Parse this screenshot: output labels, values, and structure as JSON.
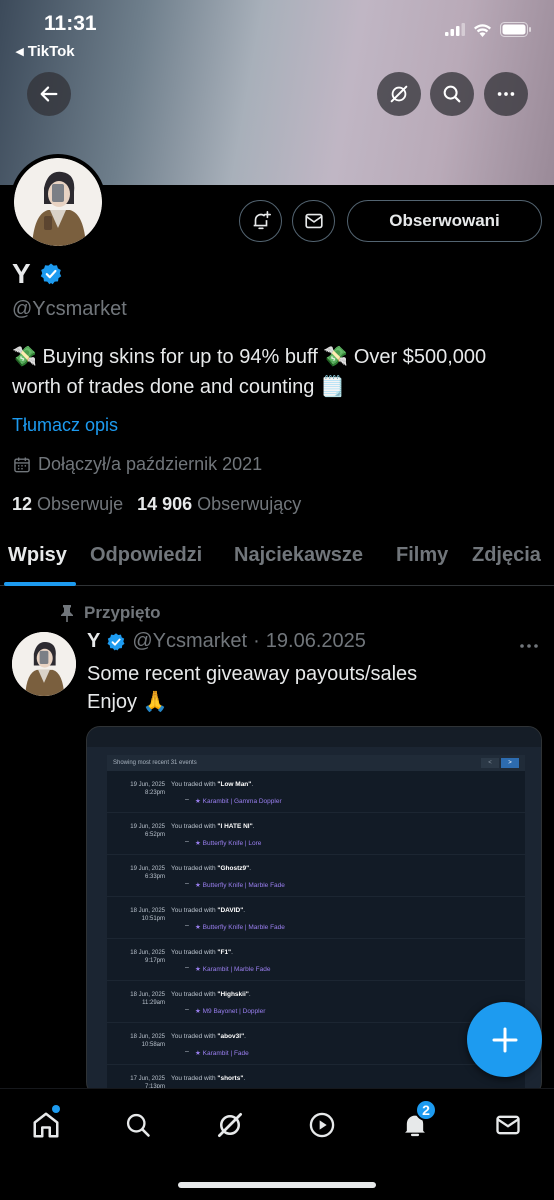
{
  "status_bar": {
    "time": "11:31",
    "back_app": "◂ TikTok"
  },
  "colors": {
    "accent": "#1d9bf0",
    "background": "#000000",
    "muted": "#71767b"
  },
  "header": {
    "back_icon": "arrow-left-icon",
    "grok_icon": "grok-icon",
    "search_icon": "search-icon",
    "more_icon": "more-icon",
    "follow_label": "Obserwowani"
  },
  "profile": {
    "name": "Y",
    "handle": "@Ycsmarket",
    "bio_line1": "💸 Buying skins for up to 94% buff 💸 Over $500,000",
    "bio_line2": "worth of trades done and counting 🗒️",
    "translate": "Tłumacz opis",
    "joined": "Dołączył/a październik 2021",
    "following_count": "12",
    "following_label": "Obserwuje",
    "followers_count": "14 906",
    "followers_label": "Obserwujący"
  },
  "tabs": [
    "Wpisy",
    "Odpowiedzi",
    "Najciekawsze",
    "Filmy",
    "Zdjęcia"
  ],
  "pinned_tweet": {
    "pinned_label": "Przypięto",
    "name": "Y",
    "handle": "@Ycsmarket",
    "separator": "·",
    "date": "19.06.2025",
    "text_line1": "Some recent giveaway payouts/sales",
    "text_line2": "Enjoy 🙏",
    "media": {
      "header": "Showing most recent 31 events",
      "pager_prev": "<",
      "pager_next": ">",
      "trades": [
        {
          "date": "19 Jun, 2025",
          "time": "8:23pm",
          "prefix": "You traded with ",
          "user": "\"Low Man\"",
          "item": "★ Karambit | Gamma Doppler"
        },
        {
          "date": "19 Jun, 2025",
          "time": "6:52pm",
          "prefix": "You traded with ",
          "user": "\"I HATE NI\"",
          "item": "★ Butterfly Knife | Lore"
        },
        {
          "date": "19 Jun, 2025",
          "time": "6:33pm",
          "prefix": "You traded with ",
          "user": "\"Ghostz9\"",
          "item": "★ Butterfly Knife | Marble Fade"
        },
        {
          "date": "18 Jun, 2025",
          "time": "10:51pm",
          "prefix": "You traded with ",
          "user": "\"DAVID\"",
          "item": "★ Butterfly Knife | Marble Fade"
        },
        {
          "date": "18 Jun, 2025",
          "time": "9:17pm",
          "prefix": "You traded with ",
          "user": "\"F1\"",
          "item": "★ Karambit | Marble Fade"
        },
        {
          "date": "18 Jun, 2025",
          "time": "11:29am",
          "prefix": "You traded with ",
          "user": "\"Highskii\"",
          "item": "★ M9 Bayonet | Doppler"
        },
        {
          "date": "18 Jun, 2025",
          "time": "10:58am",
          "prefix": "You traded with ",
          "user": "\"abov3l\"",
          "item": "★ Karambit | Fade"
        },
        {
          "date": "17 Jun, 2025",
          "time": "7:13pm",
          "prefix": "You traded with ",
          "user": "\"shorts\"",
          "item": ""
        }
      ]
    }
  },
  "fab": {
    "icon": "plus-icon"
  },
  "bottom_nav": {
    "notifications_badge": "2"
  }
}
